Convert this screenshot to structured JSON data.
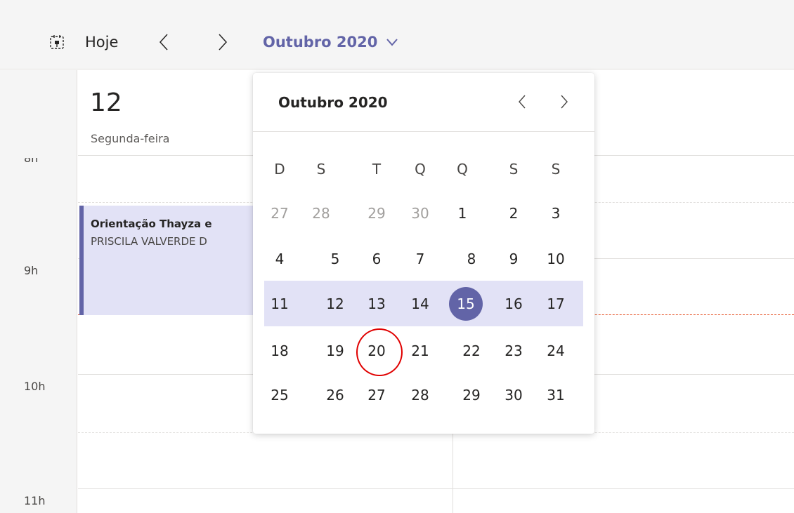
{
  "toolbar": {
    "today_label": "Hoje",
    "month_label": "Outubro 2020"
  },
  "day_header": {
    "day_number": "12",
    "day_name": "Segunda-feira"
  },
  "time_gutter": {
    "partial_label": "8h",
    "hours": [
      "9h",
      "10h",
      "11h"
    ]
  },
  "event": {
    "title": "Orientação Thayza e",
    "organizer": "PRISCILA VALVERDE D"
  },
  "date_picker": {
    "title": "Outubro 2020",
    "weekday_labels": [
      "D",
      "S",
      "T",
      "Q",
      "Q",
      "S",
      "S"
    ],
    "weeks": [
      [
        "27",
        "28",
        "29",
        "30",
        "1",
        "2",
        "3"
      ],
      [
        "4",
        "5",
        "6",
        "7",
        "8",
        "9",
        "10"
      ],
      [
        "11",
        "12",
        "13",
        "14",
        "15",
        "16",
        "17"
      ],
      [
        "18",
        "19",
        "20",
        "21",
        "22",
        "23",
        "24"
      ],
      [
        "25",
        "26",
        "27",
        "28",
        "29",
        "30",
        "31"
      ]
    ],
    "selected_day": "15",
    "circled_day": "20"
  },
  "colors": {
    "accent": "#6264a7",
    "event_bg": "#e2e2f6",
    "now_line": "#e6572c",
    "annotation": "#e00000"
  },
  "icons": [
    "today-calendar-icon",
    "chevron-left-icon",
    "chevron-right-icon",
    "chevron-down-icon"
  ]
}
